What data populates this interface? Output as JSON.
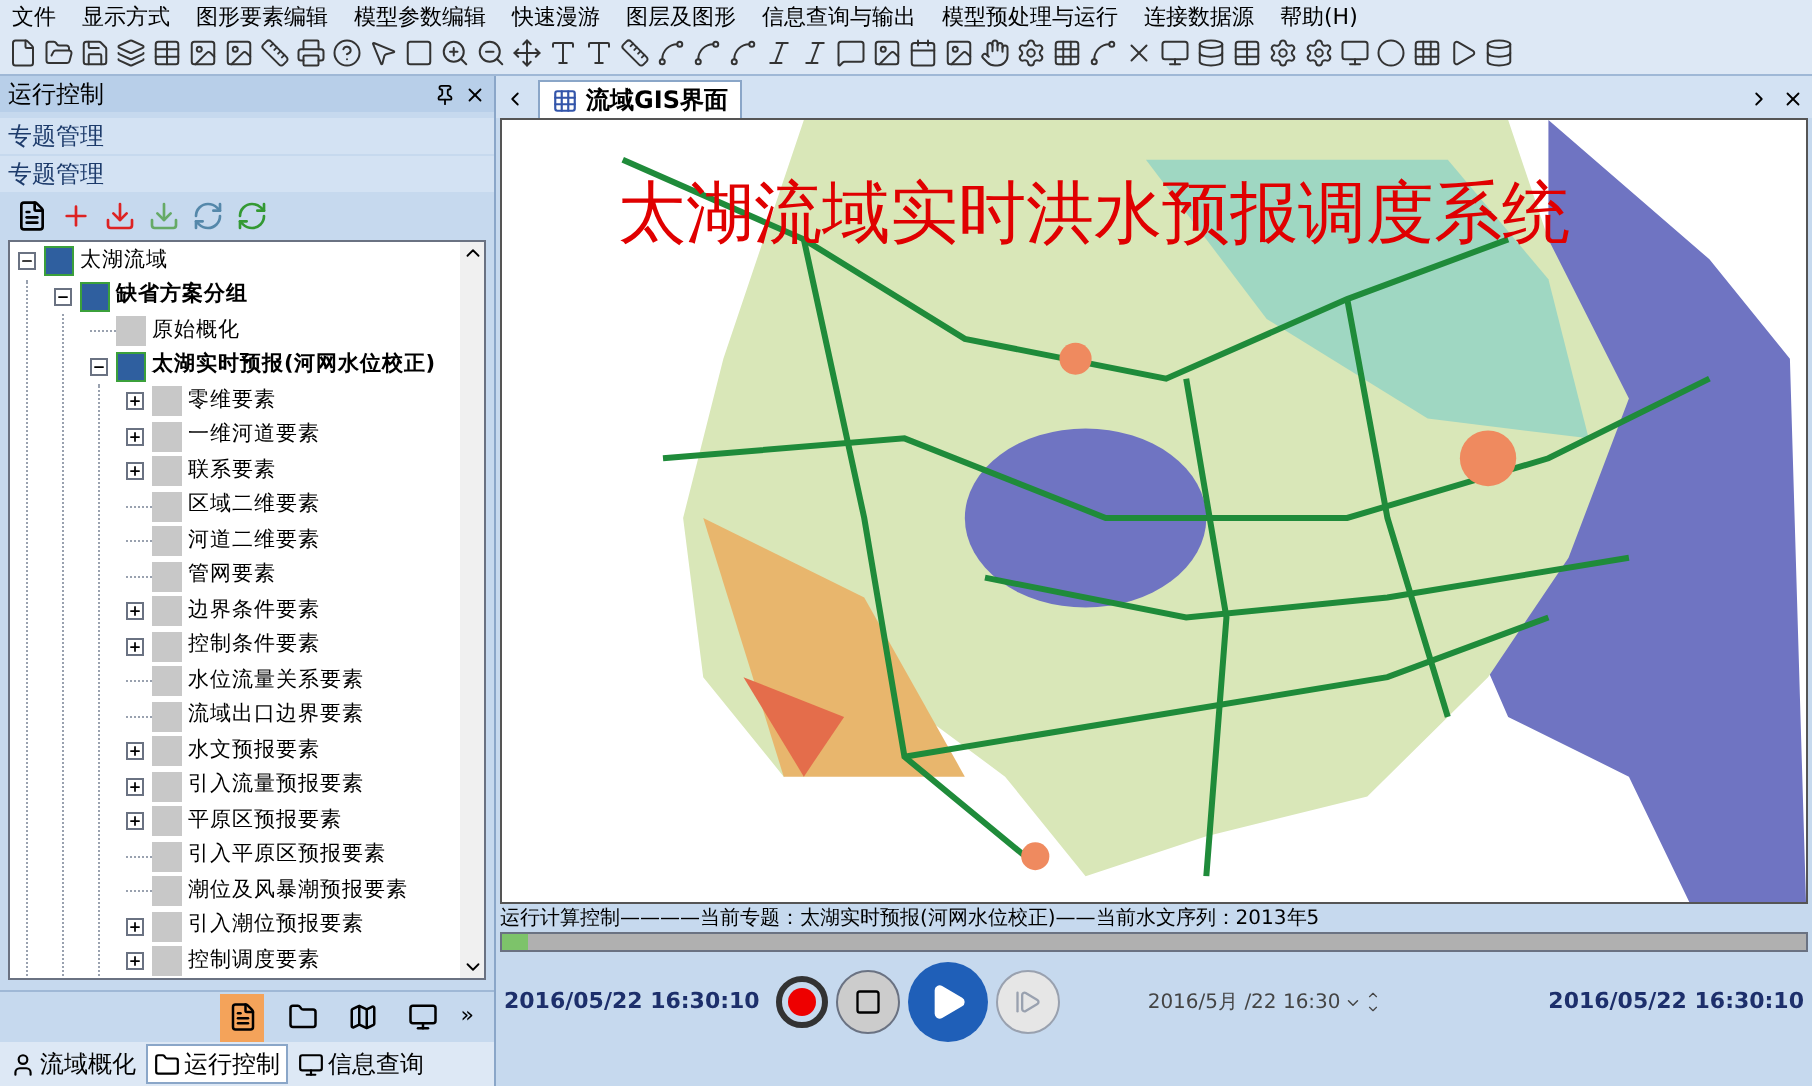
{
  "menu": [
    "文件",
    "显示方式",
    "图形要素编辑",
    "模型参数编辑",
    "快速漫游",
    "图层及图形",
    "信息查询与输出",
    "模型预处理与运行",
    "连接数据源",
    "帮助(H)"
  ],
  "left_panel": {
    "title": "运行控制",
    "section_header": "专题管理",
    "section_title": "专题管理",
    "tree": [
      {
        "label": "太湖流域",
        "expanded": true,
        "bold": false,
        "children": [
          {
            "label": "缺省方案分组",
            "expanded": true,
            "bold": true,
            "children": [
              {
                "label": "原始概化",
                "bold": false
              },
              {
                "label": "太湖实时预报(河网水位校正)",
                "expanded": true,
                "bold": true,
                "children": [
                  {
                    "label": "零维要素",
                    "expanded": false,
                    "bold": false
                  },
                  {
                    "label": "一维河道要素",
                    "expanded": false,
                    "bold": false
                  },
                  {
                    "label": "联系要素",
                    "expanded": false,
                    "bold": false
                  },
                  {
                    "label": "区域二维要素",
                    "bold": false
                  },
                  {
                    "label": "河道二维要素",
                    "bold": false
                  },
                  {
                    "label": "管网要素",
                    "bold": false
                  },
                  {
                    "label": "边界条件要素",
                    "expanded": false,
                    "bold": false
                  },
                  {
                    "label": "控制条件要素",
                    "expanded": false,
                    "bold": false
                  },
                  {
                    "label": "水位流量关系要素",
                    "bold": false
                  },
                  {
                    "label": "流域出口边界要素",
                    "bold": false
                  },
                  {
                    "label": "水文预报要素",
                    "expanded": false,
                    "bold": false
                  },
                  {
                    "label": "引入流量预报要素",
                    "expanded": false,
                    "bold": false
                  },
                  {
                    "label": "平原区预报要素",
                    "expanded": false,
                    "bold": false
                  },
                  {
                    "label": "引入平原区预报要素",
                    "bold": false
                  },
                  {
                    "label": "潮位及风暴潮预报要素",
                    "bold": false
                  },
                  {
                    "label": "引入潮位预报要素",
                    "expanded": false,
                    "bold": false
                  },
                  {
                    "label": "控制调度要素",
                    "expanded": false,
                    "bold": false
                  }
                ]
              }
            ]
          }
        ]
      }
    ],
    "view_buttons": [
      {
        "selected": true
      },
      {
        "selected": false
      },
      {
        "selected": false
      },
      {
        "selected": false
      }
    ],
    "more": "»",
    "bottom_tabs": [
      {
        "label": "流域概化",
        "selected": false
      },
      {
        "label": "运行控制",
        "selected": true
      },
      {
        "label": "信息查询",
        "selected": false
      }
    ]
  },
  "document_tab": {
    "label": "流域GIS界面"
  },
  "map": {
    "title": "太湖流域实时洪水预报调度系统"
  },
  "run_control": {
    "status": "运行计算控制————当前专题：太湖实时预报(河网水位校正)——当前水文序列：2013年5",
    "level": 0.02,
    "start_time": "2016/05/22 16:30:10",
    "current_time": "2016/5月 /22 16:30",
    "end_time": "2016/05/22 16:30:10"
  }
}
